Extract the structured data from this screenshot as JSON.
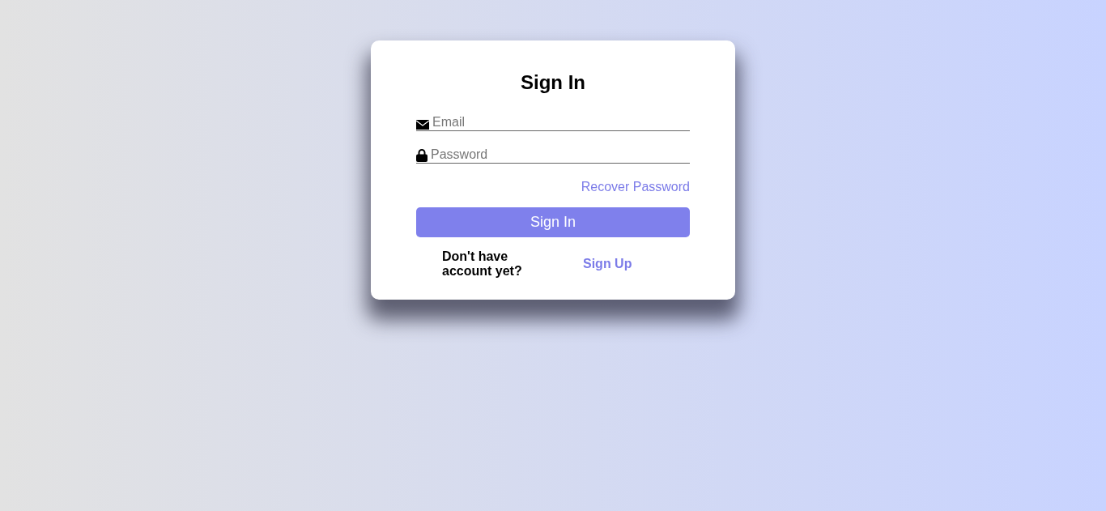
{
  "card": {
    "title": "Sign In",
    "fields": [
      {
        "kind": "email",
        "placeholder": "Email"
      },
      {
        "kind": "password",
        "placeholder": "Password"
      }
    ],
    "recover_link": "Recover Password",
    "submit_button": "Sign In",
    "signup_prompt": "Don't have account yet?",
    "signup_link": "Sign Up"
  }
}
